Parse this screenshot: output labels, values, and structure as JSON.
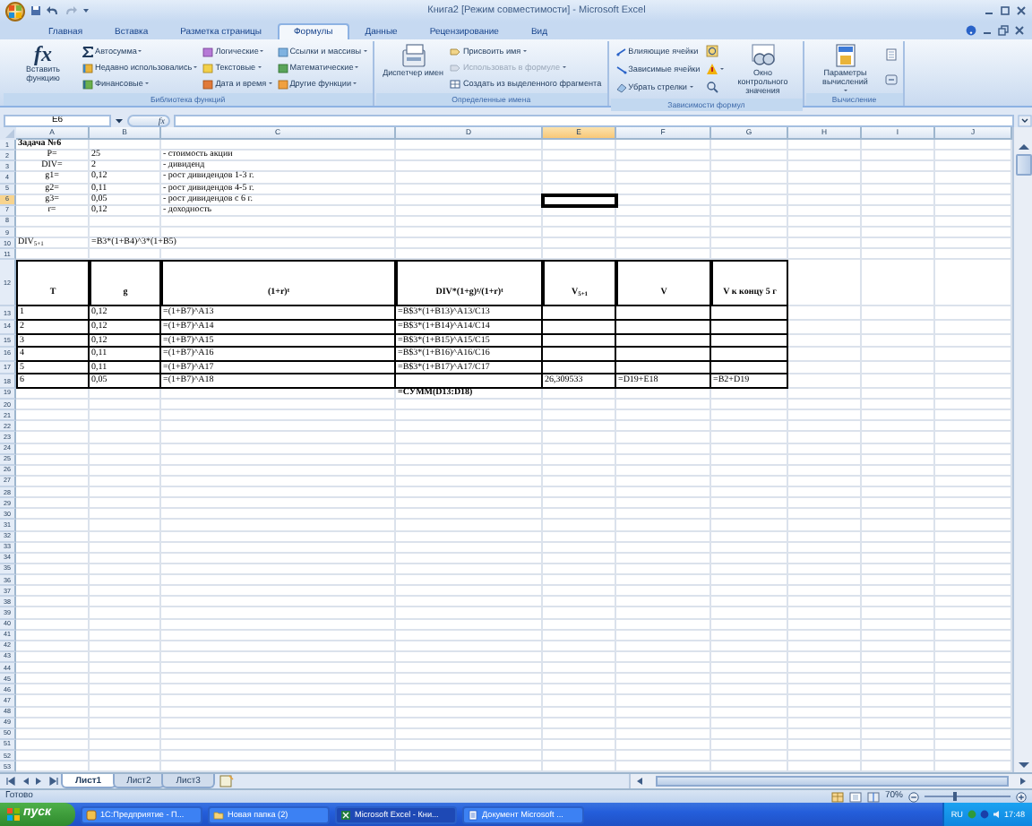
{
  "window": {
    "title": "Книга2 [Режим совместимости] - Microsoft Excel"
  },
  "ribbon_tabs": [
    {
      "label": "Главная",
      "selected": false
    },
    {
      "label": "Вставка",
      "selected": false
    },
    {
      "label": "Разметка страницы",
      "selected": false
    },
    {
      "label": "Формулы",
      "selected": true
    },
    {
      "label": "Данные",
      "selected": false
    },
    {
      "label": "Рецензирование",
      "selected": false
    },
    {
      "label": "Вид",
      "selected": false
    }
  ],
  "ribbon_groups": [
    {
      "label": "Библиотека функций",
      "parts": [
        {
          "kind": "large",
          "label": "Вставить функцию",
          "icon_text": "fx",
          "dropdown": false
        },
        {
          "kind": "column",
          "items": [
            {
              "label": "Автосумма",
              "dropdown": true,
              "disabled": false
            },
            {
              "label": "Недавно использовались",
              "dropdown": true,
              "disabled": false
            },
            {
              "label": "Финансовые",
              "dropdown": true,
              "disabled": false
            }
          ]
        },
        {
          "kind": "column",
          "items": [
            {
              "label": "Логические",
              "dropdown": true,
              "disabled": false
            },
            {
              "label": "Текстовые",
              "dropdown": true,
              "disabled": false
            },
            {
              "label": "Дата и время",
              "dropdown": true,
              "disabled": false
            }
          ]
        },
        {
          "kind": "column",
          "items": [
            {
              "label": "Ссылки и массивы",
              "dropdown": true,
              "disabled": false
            },
            {
              "label": "Математические",
              "dropdown": true,
              "disabled": false
            },
            {
              "label": "Другие функции",
              "dropdown": true,
              "disabled": false
            }
          ]
        }
      ]
    },
    {
      "label": "Определенные имена",
      "parts": [
        {
          "kind": "large",
          "label": "Диспетчер имен",
          "dropdown": false
        },
        {
          "kind": "column",
          "items": [
            {
              "label": "Присвоить имя",
              "dropdown": true,
              "disabled": false
            },
            {
              "label": "Использовать в формуле",
              "dropdown": true,
              "disabled": true
            },
            {
              "label": "Создать из выделенного фрагмента",
              "dropdown": false,
              "disabled": false
            }
          ]
        }
      ]
    },
    {
      "label": "Зависимости формул",
      "parts": [
        {
          "kind": "column",
          "items": [
            {
              "label": "Влияющие ячейки",
              "dropdown": false,
              "disabled": false
            },
            {
              "label": "Зависимые ячейки",
              "dropdown": false,
              "disabled": false
            },
            {
              "label": "Убрать стрелки",
              "dropdown": true,
              "disabled": false
            }
          ]
        },
        {
          "kind": "icons",
          "items": [
            {
              "dropdown": false
            },
            {
              "dropdown": true
            },
            {
              "dropdown": false
            }
          ]
        },
        {
          "kind": "large",
          "label": "Окно контрольного значения",
          "dropdown": false
        }
      ]
    },
    {
      "label": "Вычисление",
      "parts": [
        {
          "kind": "large",
          "label": "Параметры вычислений",
          "dropdown": true
        },
        {
          "kind": "icons",
          "items": [
            {
              "dropdown": false
            },
            {
              "dropdown": false
            }
          ]
        }
      ]
    }
  ],
  "formula_bar": {
    "name_box": "E6",
    "fx_label": "fx"
  },
  "columns": [
    {
      "label": "A",
      "selected": false
    },
    {
      "label": "B",
      "selected": false
    },
    {
      "label": "C",
      "selected": false
    },
    {
      "label": "D",
      "selected": false
    },
    {
      "label": "E",
      "selected": true
    },
    {
      "label": "F",
      "selected": false
    },
    {
      "label": "G",
      "selected": false
    },
    {
      "label": "H",
      "selected": false
    },
    {
      "label": "I",
      "selected": false
    },
    {
      "label": "J",
      "selected": false
    }
  ],
  "rows": [
    {
      "number": "1",
      "kind": "title",
      "selected": false,
      "cells": [
        "Задача №6"
      ]
    },
    {
      "number": "2",
      "kind": "param",
      "selected": false,
      "cells": [
        "P=",
        "25",
        "- стоимость акции"
      ]
    },
    {
      "number": "3",
      "kind": "param",
      "selected": false,
      "cells": [
        "DIV=",
        "2",
        "- дивиденд"
      ]
    },
    {
      "number": "4",
      "kind": "param",
      "selected": false,
      "cells": [
        "g1=",
        "0,12",
        "- рост дивидендов 1-3 г."
      ]
    },
    {
      "number": "5",
      "kind": "param",
      "selected": false,
      "cells": [
        "g2=",
        "0,11",
        "- рост дивидендов 4-5 г."
      ]
    },
    {
      "number": "6",
      "kind": "param",
      "selected": true,
      "cells": [
        "g3=",
        "0,05",
        "- рост дивидендов с 6 г."
      ]
    },
    {
      "number": "7",
      "kind": "param",
      "selected": false,
      "cells": [
        "r=",
        "0,12",
        "- доходность"
      ]
    },
    {
      "number": "8",
      "kind": "plain",
      "selected": false
    },
    {
      "number": "9",
      "kind": "plain",
      "selected": false
    },
    {
      "number": "10",
      "kind": "plain",
      "selected": false,
      "cells": [
        "DIV$_{5+1}$",
        "=B3*(1+B4)^3*(1+B5)"
      ]
    },
    {
      "number": "11",
      "kind": "plain",
      "selected": false
    },
    {
      "number": "12",
      "kind": "header",
      "selected": false,
      "cells": [
        "T",
        "g",
        "(1+r)$^{t}$",
        "DIV*(1+g)$^{t}$/(1+r)$^{t}$",
        "V$_{5+1}$",
        "V",
        "V к концу 5 г"
      ]
    },
    {
      "number": "13",
      "kind": "table",
      "selected": false,
      "cells": [
        "1",
        "0,12",
        "=(1+B7)^A13",
        "=B$3*(1+B13)^A13/C13"
      ]
    },
    {
      "number": "14",
      "kind": "table",
      "selected": false,
      "cells": [
        "2",
        "0,12",
        "=(1+B7)^A14",
        "=B$3*(1+B14)^A14/C14"
      ]
    },
    {
      "number": "15",
      "kind": "table",
      "selected": false,
      "cells": [
        "3",
        "0,12",
        "=(1+B7)^A15",
        "=B$3*(1+B15)^A15/C15"
      ]
    },
    {
      "number": "16",
      "kind": "table",
      "selected": false,
      "cells": [
        "4",
        "0,11",
        "=(1+B7)^A16",
        "=B$3*(1+B16)^A16/C16"
      ]
    },
    {
      "number": "17",
      "kind": "table",
      "selected": false,
      "cells": [
        "5",
        "0,11",
        "=(1+B7)^A17",
        "=B$3*(1+B17)^A17/C17"
      ]
    },
    {
      "number": "18",
      "kind": "table",
      "selected": false,
      "cells": [
        "6",
        "0,05",
        "=(1+B7)^A18",
        null,
        "26,309533",
        "=D19+E18",
        "=B2+D19"
      ]
    },
    {
      "number": "19",
      "kind": "total",
      "selected": false,
      "cells": [
        null,
        null,
        null,
        "=СУММ(D13:D18)"
      ]
    },
    {
      "number": "20",
      "kind": "plain",
      "selected": false
    },
    {
      "number": "21",
      "kind": "plain",
      "selected": false
    },
    {
      "number": "22",
      "kind": "plain",
      "selected": false
    },
    {
      "number": "23",
      "kind": "plain",
      "selected": false
    },
    {
      "number": "24",
      "kind": "plain",
      "selected": false
    },
    {
      "number": "25",
      "kind": "plain",
      "selected": false
    },
    {
      "number": "26",
      "kind": "plain",
      "selected": false
    },
    {
      "number": "27",
      "kind": "plain",
      "selected": false
    },
    {
      "number": "28",
      "kind": "plain",
      "selected": false
    },
    {
      "number": "29",
      "kind": "plain",
      "selected": false
    },
    {
      "number": "30",
      "kind": "plain",
      "selected": false
    },
    {
      "number": "31",
      "kind": "plain",
      "selected": false
    },
    {
      "number": "32",
      "kind": "plain",
      "selected": false
    },
    {
      "number": "33",
      "kind": "plain",
      "selected": false
    },
    {
      "number": "34",
      "kind": "plain",
      "selected": false
    },
    {
      "number": "35",
      "kind": "plain",
      "selected": false
    },
    {
      "number": "36",
      "kind": "plain",
      "selected": false
    },
    {
      "number": "37",
      "kind": "plain",
      "selected": false
    },
    {
      "number": "38",
      "kind": "plain",
      "selected": false
    },
    {
      "number": "39",
      "kind": "plain",
      "selected": false
    },
    {
      "number": "40",
      "kind": "plain",
      "selected": false
    },
    {
      "number": "41",
      "kind": "plain",
      "selected": false
    },
    {
      "number": "42",
      "kind": "plain",
      "selected": false
    },
    {
      "number": "43",
      "kind": "plain",
      "selected": false
    },
    {
      "number": "44",
      "kind": "plain",
      "selected": false
    },
    {
      "number": "45",
      "kind": "plain",
      "selected": false
    },
    {
      "number": "46",
      "kind": "plain",
      "selected": false
    },
    {
      "number": "47",
      "kind": "plain",
      "selected": false
    },
    {
      "number": "48",
      "kind": "plain",
      "selected": false
    },
    {
      "number": "49",
      "kind": "plain",
      "selected": false
    },
    {
      "number": "50",
      "kind": "plain",
      "selected": false
    },
    {
      "number": "51",
      "kind": "plain",
      "selected": false
    },
    {
      "number": "52",
      "kind": "plain",
      "selected": false
    },
    {
      "number": "53",
      "kind": "plain",
      "selected": false
    }
  ],
  "sheet_tabs": [
    {
      "label": "Лист1",
      "selected": true
    },
    {
      "label": "Лист2",
      "selected": false
    },
    {
      "label": "Лист3",
      "selected": false
    }
  ],
  "status_bar": {
    "text": "Готово",
    "zoom": "70%",
    "zoom_slider": {
      "level": 0.33
    }
  },
  "taskbar": {
    "start": "пуск",
    "tasks": [
      {
        "label": "1С:Предприятие - П...",
        "selected": false
      },
      {
        "label": "Новая папка (2)",
        "selected": false
      },
      {
        "label": "Microsoft Excel - Кни...",
        "selected": true
      },
      {
        "label": "Документ Microsoft ...",
        "selected": false
      }
    ],
    "language": "RU",
    "clock": "17:48"
  }
}
